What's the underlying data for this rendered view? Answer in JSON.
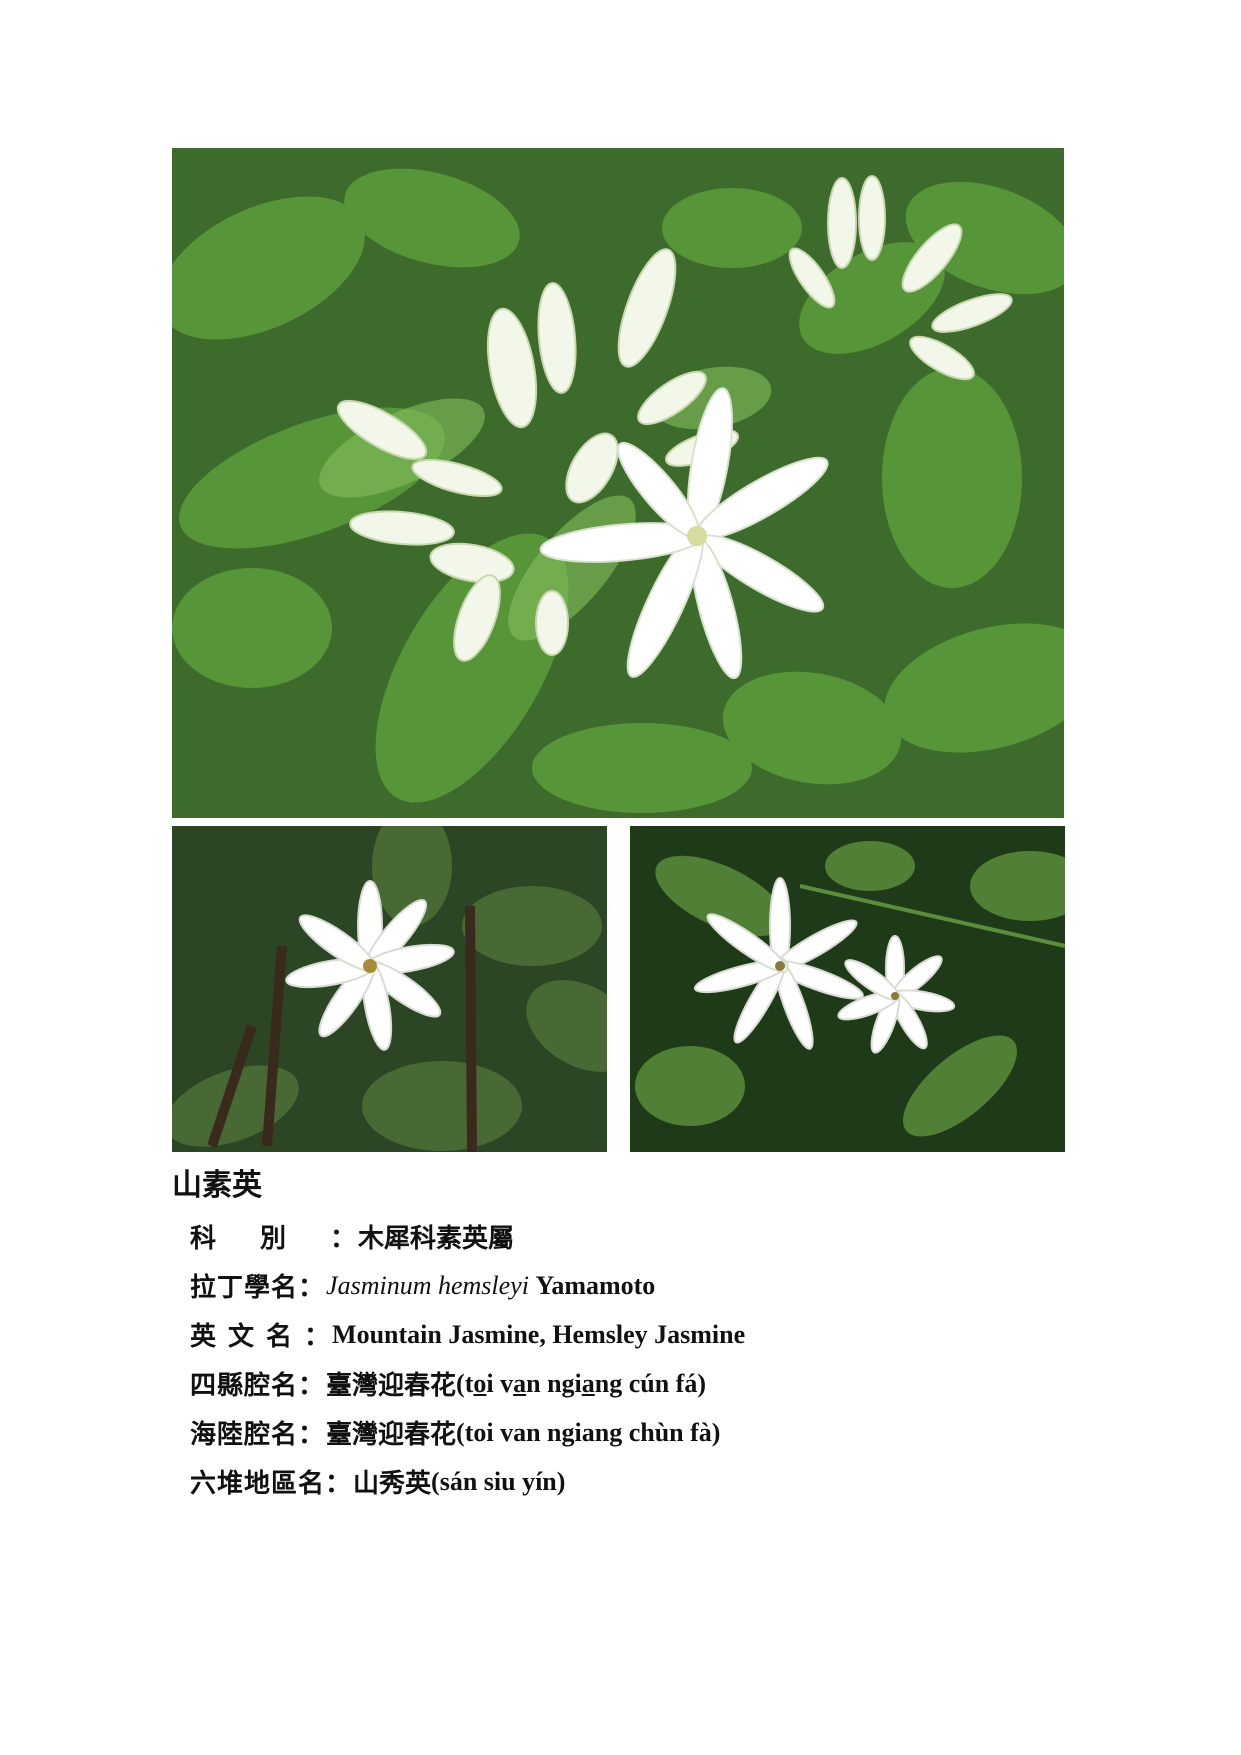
{
  "species": {
    "name": "山素英",
    "family_label": "科別",
    "family_value": "木犀科素英屬",
    "latin_label": "拉丁學名",
    "latin_genus_species": "Jasminum hemsleyi",
    "latin_author": "Yamamoto",
    "english_label": "英文名",
    "english_value": "Mountain Jasmine, Hemsley Jasmine",
    "sixian_label": "四縣腔名",
    "sixian_name": "臺灣迎春花",
    "sixian_roman_parts": [
      "(t",
      "o",
      "i v",
      "a",
      "n ngi",
      "a",
      "ng cún fá)"
    ],
    "hailu_label": "海陸腔名",
    "hailu_name": "臺灣迎春花",
    "hailu_roman": "(toi van ngiang chùn fà)",
    "liudui_label": "六堆地區名",
    "liudui_name": "山秀英",
    "liudui_roman": "(sán siu yín)"
  },
  "colon": "：",
  "colors": {
    "leaf_dark": "#2f5a23",
    "leaf_mid": "#4f8a34",
    "leaf_light": "#7fb55a",
    "petal": "#ffffff"
  }
}
